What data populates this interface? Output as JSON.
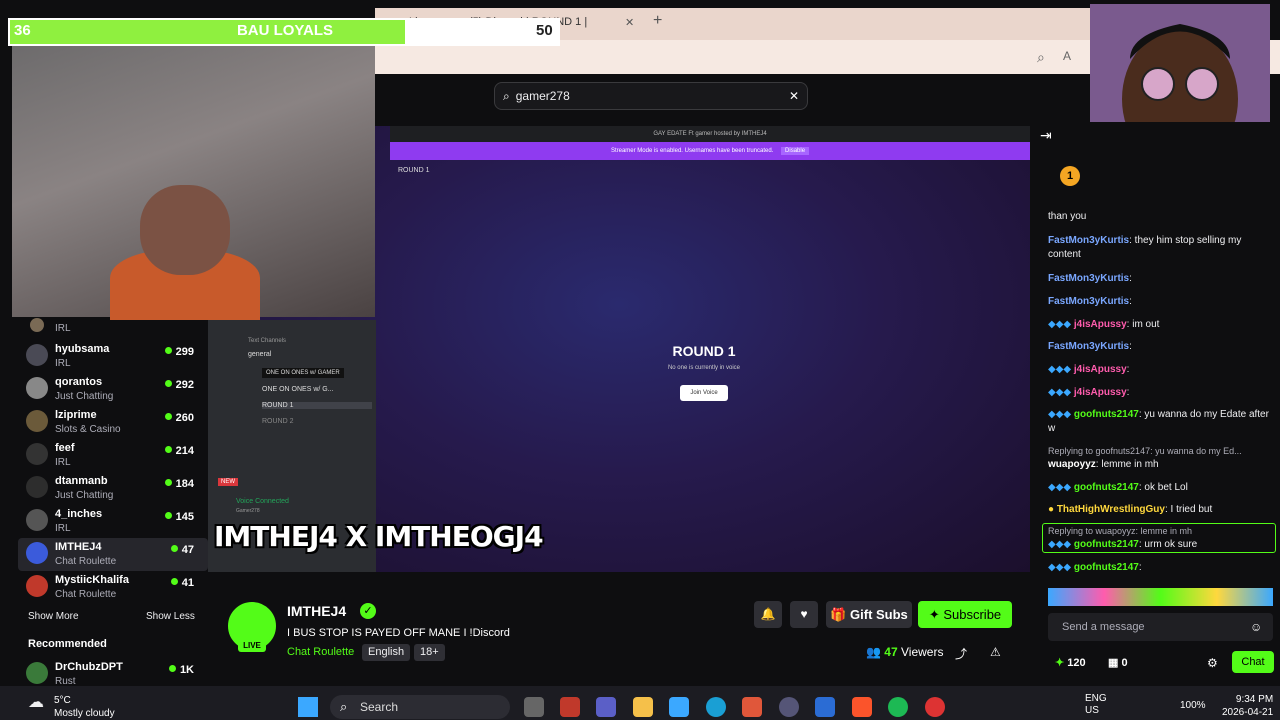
{
  "browser": {
    "tab_partial": "Li",
    "tab_discord": "(5) Discord | ROUND 1 |",
    "new_tab_icon": "plus-icon"
  },
  "search": {
    "value": "gamer278",
    "icon": "search-icon",
    "clear_icon": "close-icon"
  },
  "goal": {
    "start": "36",
    "label": "BAU LOYALS",
    "end": "50",
    "progress": 0.72
  },
  "sidebar": {
    "items": [
      {
        "name": "",
        "category": "IRL",
        "viewers": ""
      },
      {
        "name": "hyubsama",
        "category": "IRL",
        "viewers": "299"
      },
      {
        "name": "qorantos",
        "category": "Just Chatting",
        "viewers": "292"
      },
      {
        "name": "lziprime",
        "category": "Slots & Casino",
        "viewers": "260"
      },
      {
        "name": "feef",
        "category": "IRL",
        "viewers": "214"
      },
      {
        "name": "dtanmanb",
        "category": "Just Chatting",
        "viewers": "184"
      },
      {
        "name": "4_inches",
        "category": "IRL",
        "viewers": "145"
      },
      {
        "name": "IMTHEJ4",
        "category": "Chat Roulette",
        "viewers": "47"
      },
      {
        "name": "MystiicKhalifa",
        "category": "Chat Roulette",
        "viewers": "41"
      }
    ],
    "show_more": "Show More",
    "show_less": "Show Less",
    "recommended": "Recommended",
    "rec_name": "DrChubzDPT",
    "rec_viewers": "1K",
    "rec_category": "Rust"
  },
  "video": {
    "discord_title": "GAY EDATE Ft gamer hosted by IMTHEJ4",
    "streamer_mode": "Streamer Mode is enabled. Usernames have been truncated.",
    "disable": "Disable",
    "round_label": "ROUND 1",
    "round_title": "ROUND 1",
    "no_one": "No one is currently in voice",
    "join_voice": "Join Voice",
    "channels_header": "Text Channels",
    "channels": [
      "general",
      "ONE ON ONES w/ GAMER",
      "ONE ON ONES w/ G...",
      "ROUND 1",
      "ROUND 2"
    ],
    "voice_connected": "Voice Connected",
    "voice_user": "Gamer278",
    "overlay": "IMTHEJ4 X IMTHEOGJ4",
    "new_badge": "NEW"
  },
  "stream": {
    "name": "IMTHEJ4",
    "live": "LIVE",
    "title": "I BUS STOP IS PAYED OFF MANE I   !Discord",
    "category": "Chat Roulette",
    "tags": [
      "English",
      "18+"
    ],
    "gift_subs": "Gift Subs",
    "subscribe": "Subscribe",
    "viewers_count": "47",
    "viewers_label": "Viewers"
  },
  "chat": {
    "pinned_count": "1",
    "lines": [
      {
        "user": "",
        "text": "than you"
      },
      {
        "user": "FastMon3yKurtis",
        "text": ": they him stop selling my content"
      },
      {
        "user": "FastMon3yKurtis",
        "text": ":"
      },
      {
        "user": "FastMon3yKurtis",
        "text": ":"
      },
      {
        "user": "j4isApussy",
        "text": ": im out"
      },
      {
        "user": "FastMon3yKurtis",
        "text": ":"
      },
      {
        "user": "j4isApussy",
        "text": ":"
      },
      {
        "user": "j4isApussy",
        "text": ":"
      },
      {
        "user": "goofnuts2147",
        "text": ": yu wanna do my Edate after w"
      },
      {
        "user": "wuapoyyz",
        "text": ": lemme in mh"
      },
      {
        "user": "goofnuts2147",
        "text": ": ok bet Lol"
      },
      {
        "user": "ThatHighWrestlingGuy",
        "text": ": I tried but"
      },
      {
        "user": "goofnuts2147",
        "text": ": urm ok sure"
      },
      {
        "user": "goofnuts2147",
        "text": ":"
      }
    ],
    "reply1": "Replying to goofnuts2147: yu wanna do my Ed...",
    "reply2": "Replying to wuapoyyz: lemme in mh",
    "placeholder": "Send a message",
    "points": "120",
    "inventory": "0",
    "chat_button": "Chat"
  },
  "taskbar": {
    "temp": "5°C",
    "weather": "Mostly cloudy",
    "search": "Search",
    "lang1": "ENG",
    "lang2": "US",
    "battery": "100%",
    "time": "9:34 PM",
    "date": "2026-04-21"
  },
  "colors": {
    "accent": "#53fc18",
    "bg": "#0e0e10",
    "goal_fill": "#8ff03f",
    "discord_banner": "#8f3bf0"
  }
}
